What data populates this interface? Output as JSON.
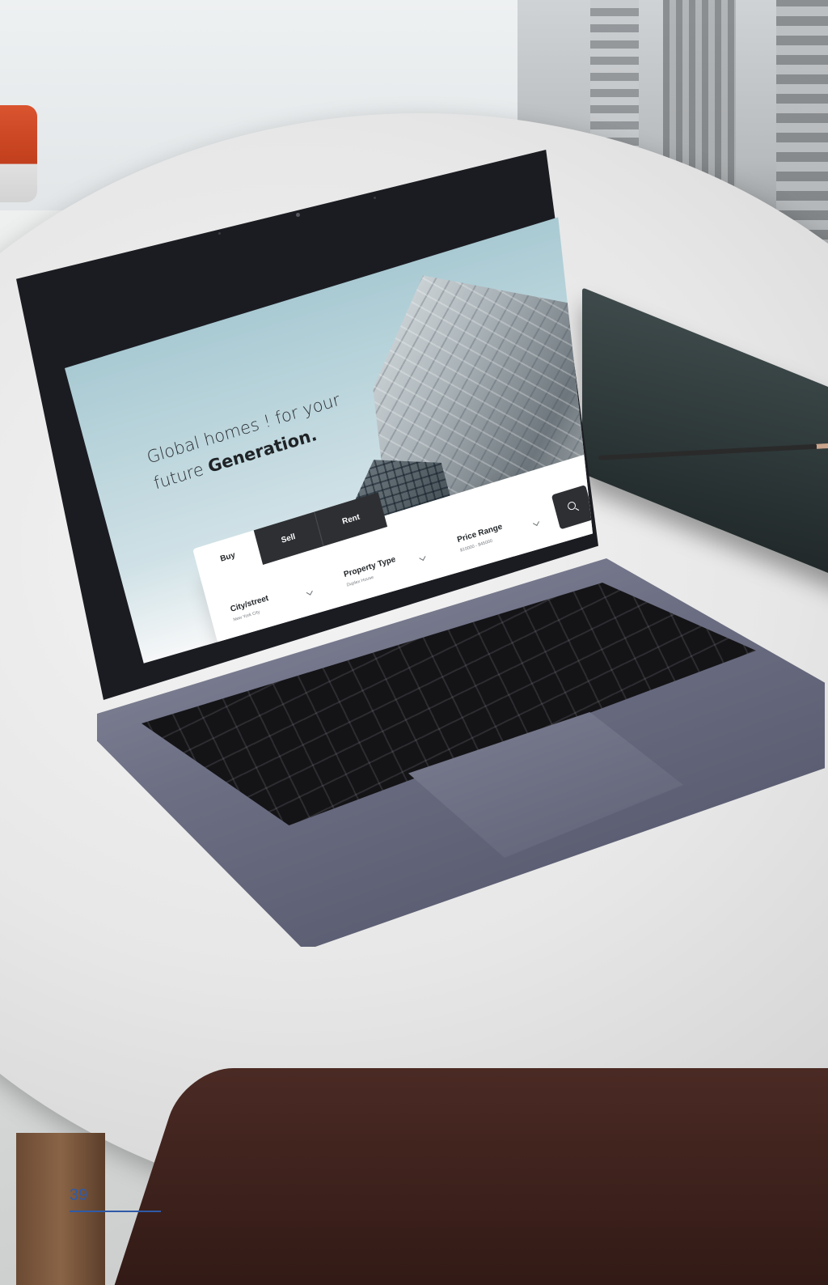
{
  "hero": {
    "title_line1": "Global homes ! for your",
    "title_line2_prefix": "future ",
    "title_line2_bold": "Generation."
  },
  "search": {
    "tabs": [
      {
        "label": "Buy",
        "active": true
      },
      {
        "label": "Sell",
        "active": false
      },
      {
        "label": "Rent",
        "active": false
      }
    ],
    "fields": [
      {
        "label": "City/street",
        "value": "New York City"
      },
      {
        "label": "Property Type",
        "value": "Duplex House"
      },
      {
        "label": "Price Range",
        "value": "$10000 - $45000"
      }
    ],
    "button_icon": "search-icon"
  },
  "page": {
    "number": "39"
  },
  "colors": {
    "accent": "#2f5aa8",
    "dark_tab": "#2d2f33"
  }
}
